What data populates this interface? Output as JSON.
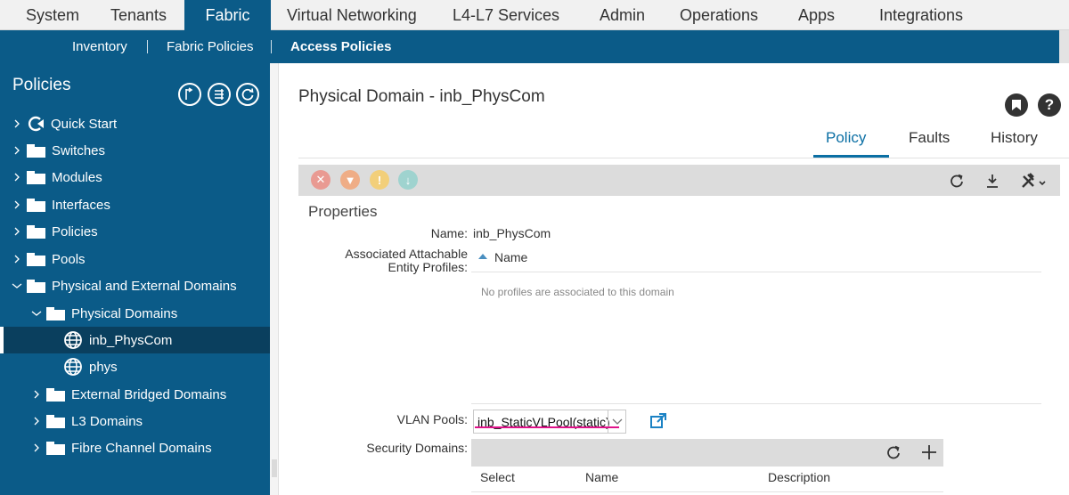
{
  "top_nav": {
    "tabs": [
      "System",
      "Tenants",
      "Fabric",
      "Virtual Networking",
      "L4-L7 Services",
      "Admin",
      "Operations",
      "Apps",
      "Integrations"
    ],
    "active": "Fabric"
  },
  "sub_nav": {
    "items": [
      "Inventory",
      "Fabric Policies",
      "Access Policies"
    ],
    "active": "Access Policies"
  },
  "sidebar": {
    "title": "Policies",
    "tree": [
      {
        "label": "Quick Start",
        "icon": "quick-start-icon"
      },
      {
        "label": "Switches",
        "icon": "folder-icon"
      },
      {
        "label": "Modules",
        "icon": "folder-icon"
      },
      {
        "label": "Interfaces",
        "icon": "folder-icon"
      },
      {
        "label": "Policies",
        "icon": "folder-icon"
      },
      {
        "label": "Pools",
        "icon": "folder-icon"
      },
      {
        "label": "Physical and External Domains",
        "icon": "folder-icon"
      },
      {
        "label": "Physical Domains",
        "icon": "folder-icon"
      },
      {
        "label": "inb_PhysCom",
        "icon": "globe-icon"
      },
      {
        "label": "phys",
        "icon": "globe-icon"
      },
      {
        "label": "External Bridged Domains",
        "icon": "folder-icon"
      },
      {
        "label": "L3 Domains",
        "icon": "folder-icon"
      },
      {
        "label": "Fibre Channel Domains",
        "icon": "folder-icon"
      }
    ],
    "selected": "inb_PhysCom"
  },
  "page": {
    "title": "Physical Domain - inb_PhysCom",
    "tabs": [
      "Policy",
      "Faults",
      "History"
    ],
    "active_tab": "Policy",
    "section": "Properties",
    "name_label": "Name:",
    "name_value": "inb_PhysCom",
    "aep_label_line1": "Associated Attachable",
    "aep_label_line2": "Entity Profiles:",
    "aep_column": "Name",
    "aep_empty": "No profiles are associated to this domain",
    "vlan_label": "VLAN Pools:",
    "vlan_value": "inb_StaticVLPool(static)",
    "security_label": "Security Domains:",
    "security_columns": [
      "Select",
      "Name",
      "Description"
    ]
  },
  "colors": {
    "brand": "#0b5b88",
    "accent": "#0b6fa4",
    "highlight": "#e0128a",
    "fault_critical": "#e99a92",
    "fault_major": "#efad86",
    "fault_minor": "#f2cf7a",
    "fault_warning": "#9fd3cf"
  }
}
